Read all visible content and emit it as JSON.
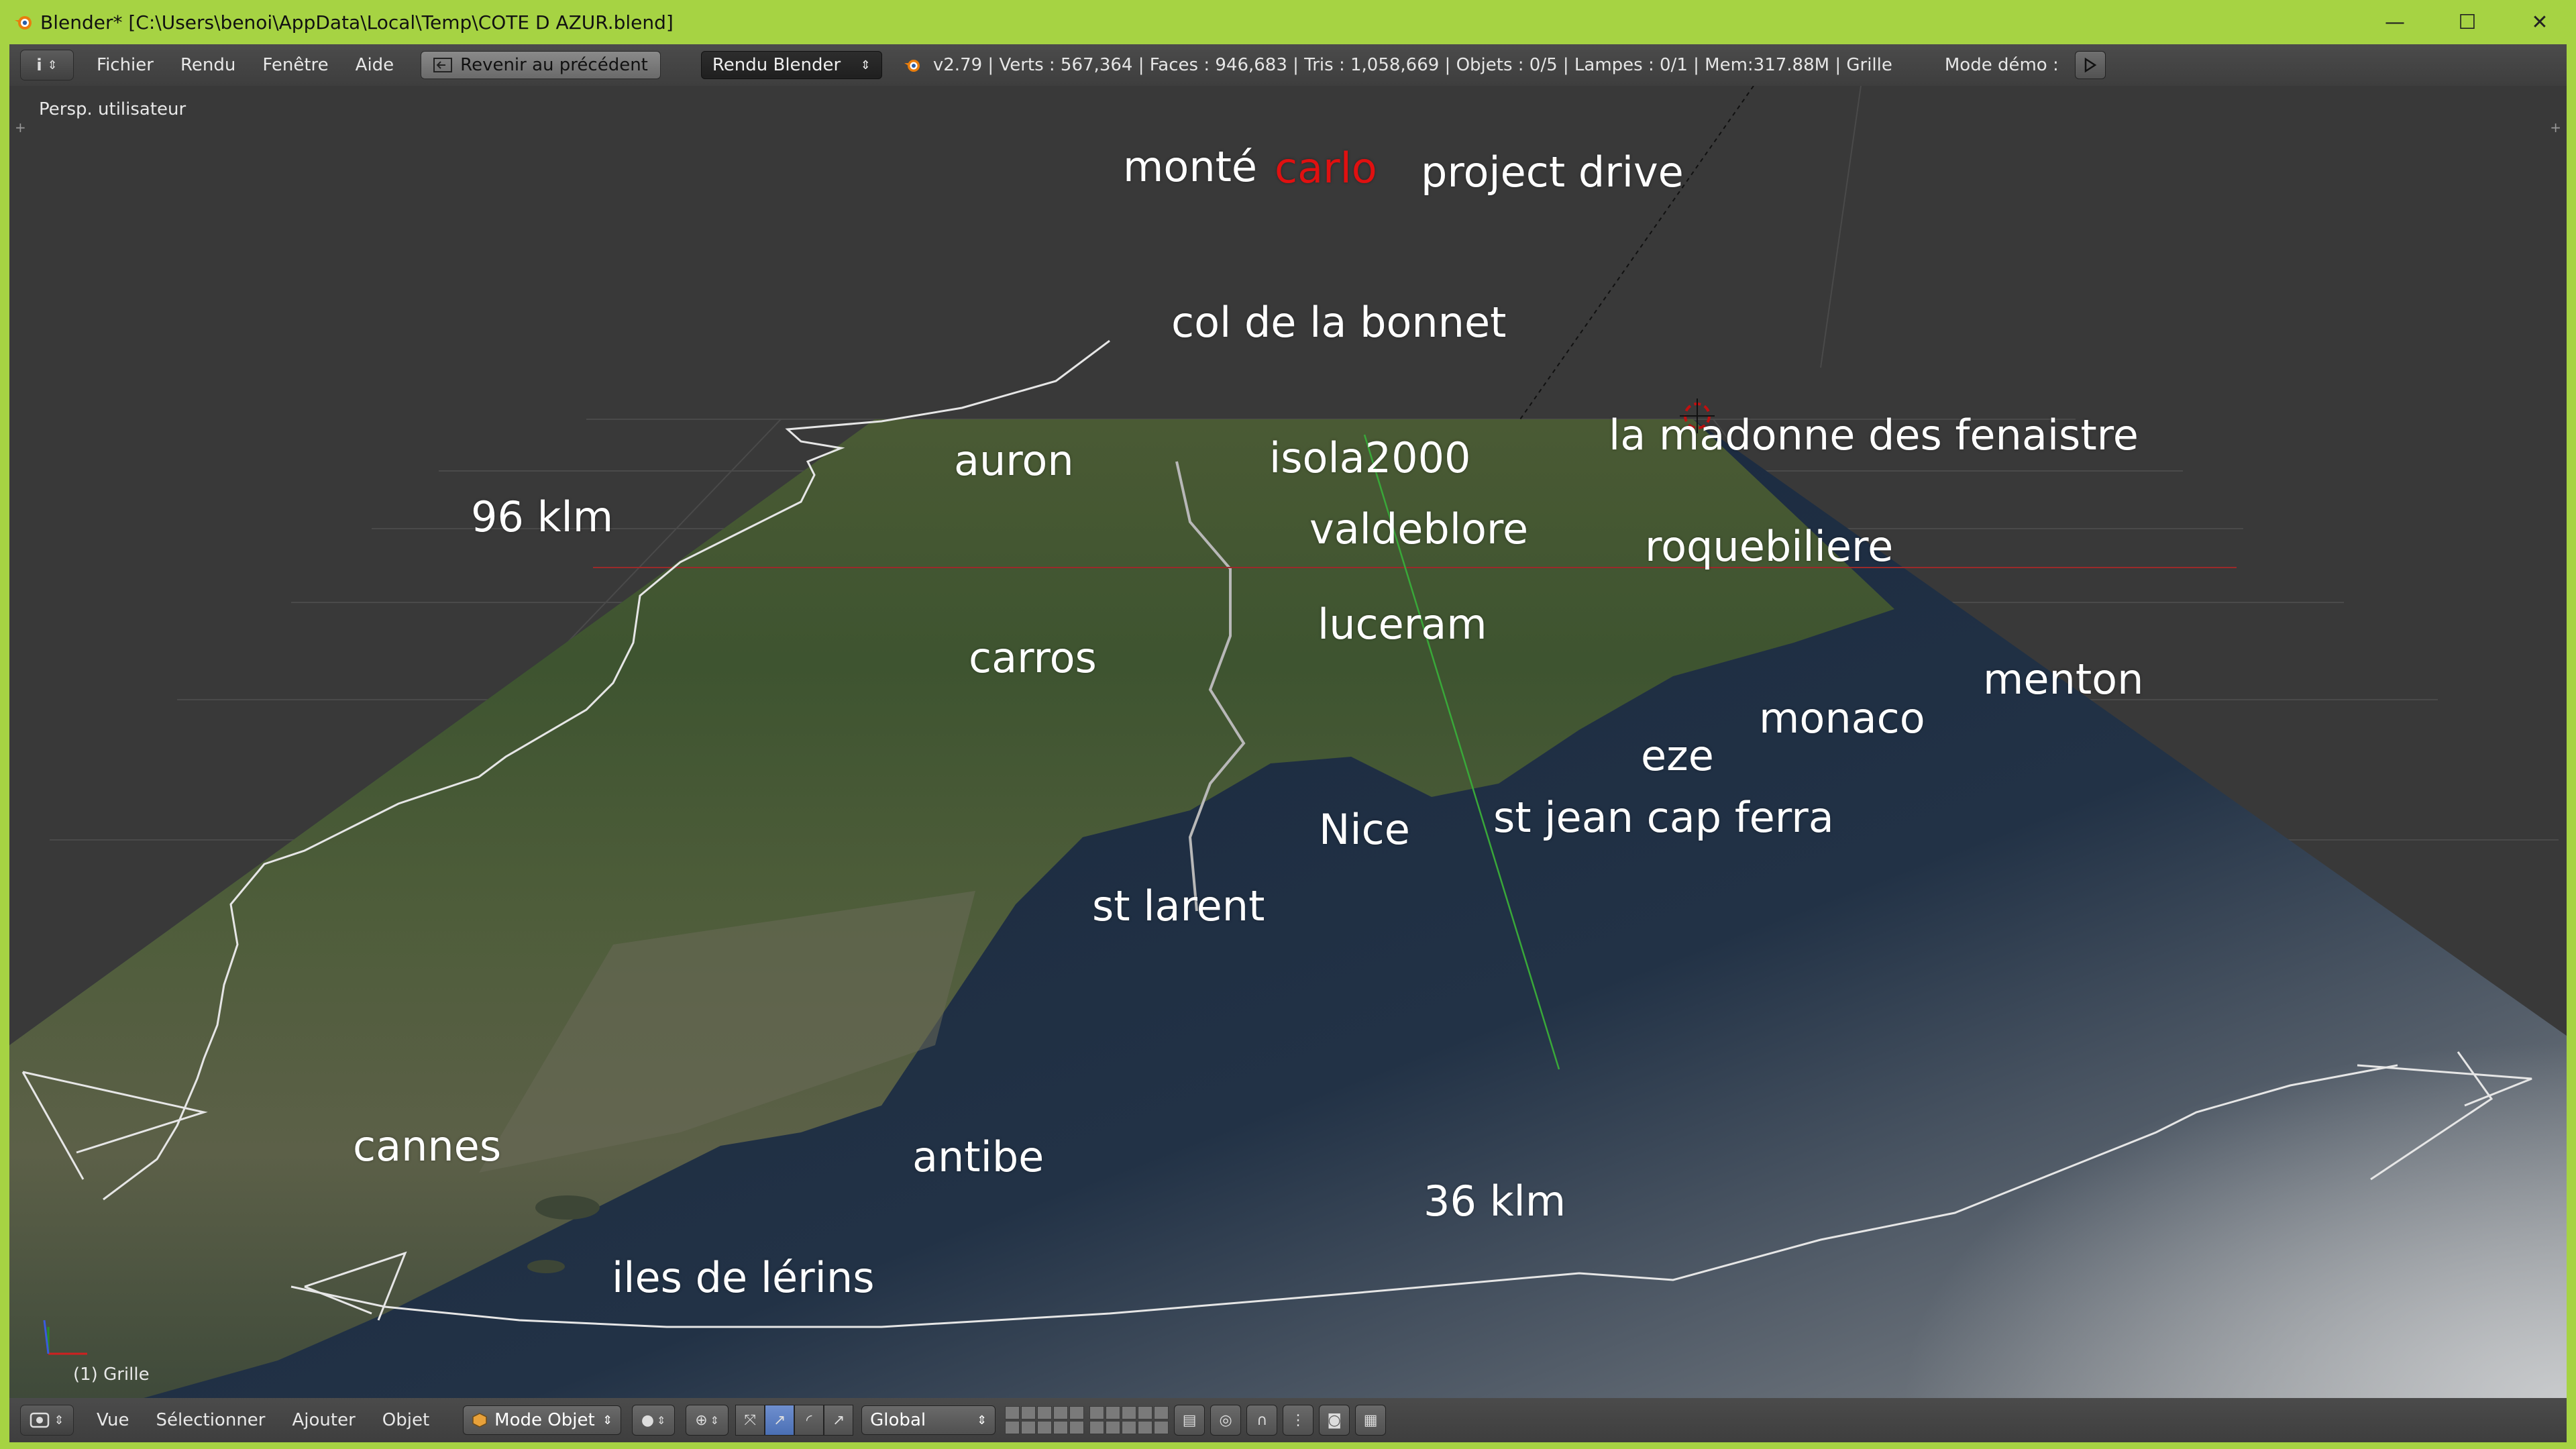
{
  "window": {
    "title": "Blender* [C:\\Users\\benoi\\AppData\\Local\\Temp\\COTE D AZUR.blend]",
    "controls": [
      "—",
      "☐",
      "✕"
    ]
  },
  "infobar": {
    "editor_icon": "i",
    "menus": [
      "Fichier",
      "Rendu",
      "Fenêtre",
      "Aide"
    ],
    "back_button": "Revenir au précédent",
    "render_engine": "Rendu Blender",
    "stats": "v2.79 | Verts : 567,364 | Faces : 946,683 | Tris : 1,058,669 | Objets : 0/5 | Lampes : 0/1 | Mem:317.88M | Grille",
    "demo_mode": "Mode démo :"
  },
  "viewport": {
    "view_label": "Persp. utilisateur",
    "object_label": "(1) Grille",
    "colors": {
      "background": "#393939",
      "label": "#ffffff",
      "highlight": "#e01010"
    },
    "labels": {
      "monte": "monté",
      "carlo": "carlo",
      "project_drive": "project drive",
      "col_bonnet": "col de la bonnet",
      "auron": "auron",
      "isola": "isola2000",
      "madonne": "la madonne des fenaistre",
      "dist_96": "96 klm",
      "valdeblore": "valdeblore",
      "roquebiliere": "roquebiliere",
      "luceram": "luceram",
      "carros": "carros",
      "menton": "menton",
      "monaco": "monaco",
      "eze": "eze",
      "nice": "Nice",
      "st_jean": "st jean cap ferra",
      "st_larent": "st larent",
      "cannes": "cannes",
      "antibe": "antibe",
      "dist_36": "36 klm",
      "lerins": "iles de lérins"
    }
  },
  "bottombar": {
    "menus": [
      "Vue",
      "Sélectionner",
      "Ajouter",
      "Objet"
    ],
    "mode": "Mode Objet",
    "orientation": "Global"
  }
}
